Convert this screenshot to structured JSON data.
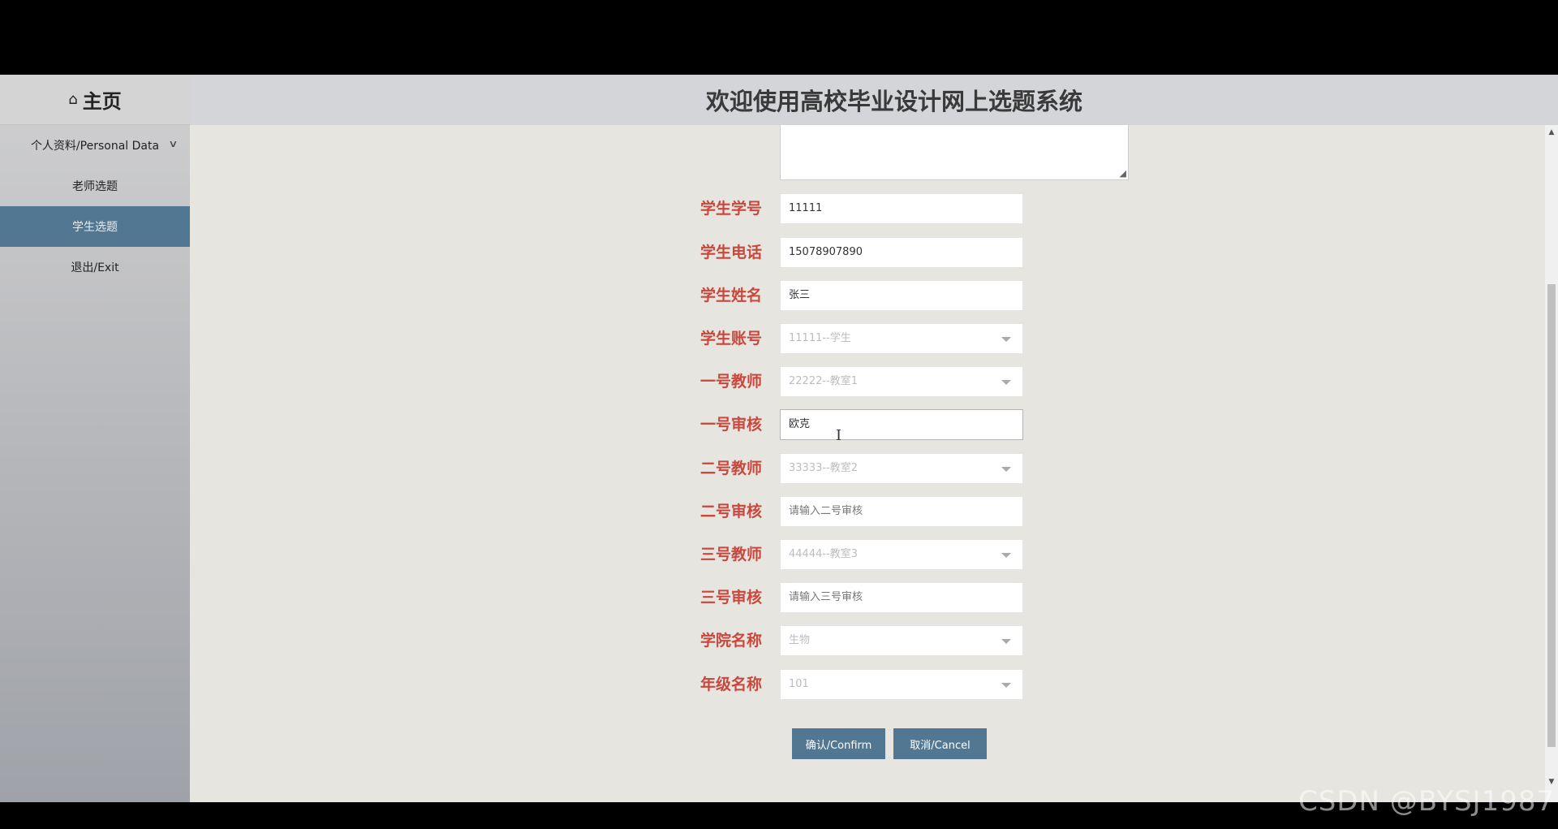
{
  "sidebar": {
    "home_label": "主页",
    "home_icon": "home-icon",
    "items": [
      {
        "label": "个人资料/Personal Data"
      },
      {
        "label": "老师选题"
      },
      {
        "label": "学生选题"
      },
      {
        "label": "退出/Exit"
      }
    ]
  },
  "header": {
    "title": "欢迎使用高校毕业设计网上选题系统"
  },
  "form": {
    "fields": [
      {
        "label": "学生学号",
        "value": "11111"
      },
      {
        "label": "学生电话",
        "value": "15078907890"
      },
      {
        "label": "学生姓名",
        "value": "张三"
      },
      {
        "label": "学生账号",
        "value": "11111--学生"
      },
      {
        "label": "一号教师",
        "value": "22222--教室1"
      },
      {
        "label": "一号审核",
        "value": "欧克"
      },
      {
        "label": "二号教师",
        "value": "33333--教室2"
      },
      {
        "label": "二号审核",
        "placeholder": "请输入二号审核"
      },
      {
        "label": "三号教师",
        "value": "44444--教室3"
      },
      {
        "label": "三号审核",
        "placeholder": "请输入三号审核"
      },
      {
        "label": "学院名称",
        "value": "生物"
      },
      {
        "label": "年级名称",
        "value": "101"
      }
    ],
    "confirm_label": "确认/Confirm",
    "cancel_label": "取消/Cancel"
  },
  "watermark": "CSDN @BYSJ1987",
  "colors": {
    "accent": "#527792",
    "label_red": "#c9473c",
    "content_bg": "#e6e5e0"
  }
}
